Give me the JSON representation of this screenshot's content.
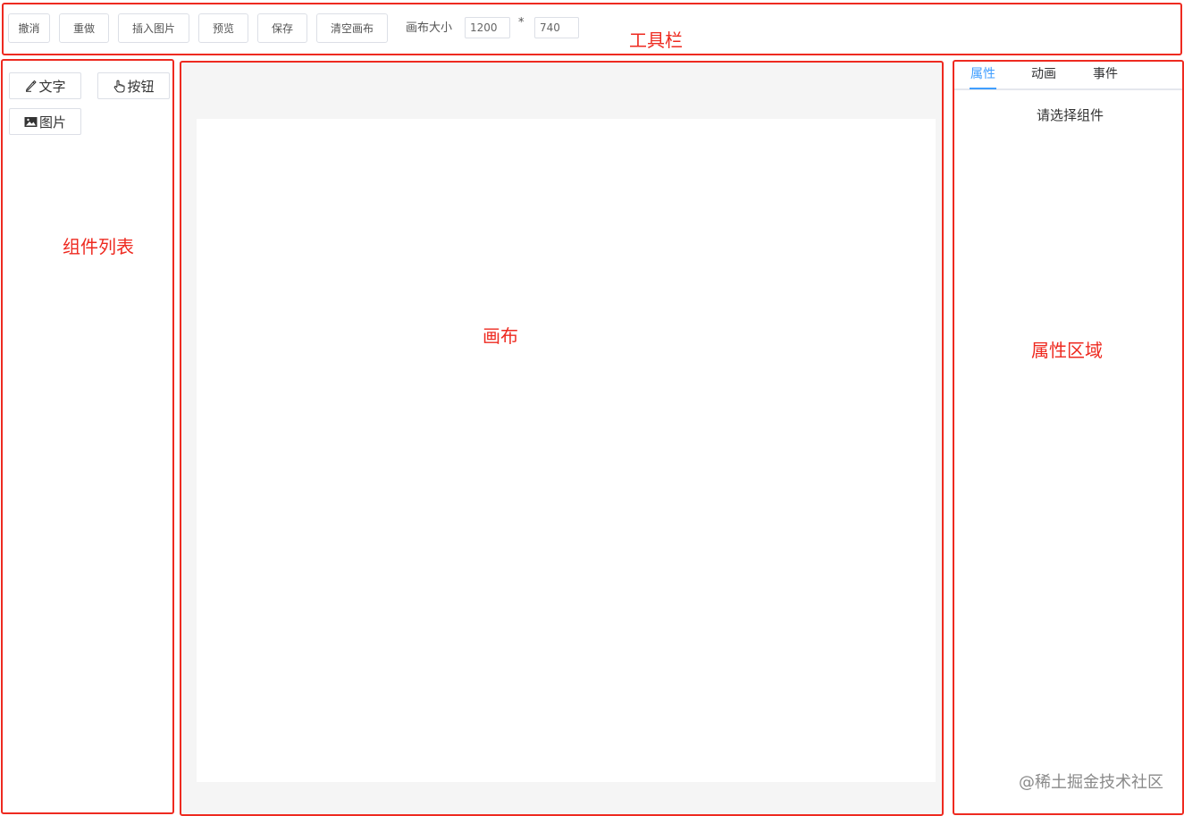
{
  "toolbar": {
    "buttons": [
      "撤消",
      "重做",
      "插入图片",
      "预览",
      "保存",
      "清空画布"
    ],
    "canvas_size_label": "画布大小",
    "width_value": "1200",
    "separator": "*",
    "height_value": "740",
    "annotation": "工具栏"
  },
  "components": {
    "items": [
      {
        "label": "文字",
        "icon": "pencil-icon"
      },
      {
        "label": "按钮",
        "icon": "hand-pointer-icon"
      },
      {
        "label": "图片",
        "icon": "image-icon"
      }
    ],
    "annotation": "组件列表"
  },
  "canvas": {
    "annotation": "画布",
    "background": "#f5f5f5"
  },
  "props": {
    "tabs": [
      "属性",
      "动画",
      "事件"
    ],
    "active_tab": "属性",
    "placeholder": "请选择组件",
    "annotation": "属性区域"
  },
  "watermark": "@稀土掘金技术社区",
  "colors": {
    "annotation_red": "#ee2a20",
    "accent_blue": "#409eff",
    "border_gray": "#dcdfe6"
  }
}
